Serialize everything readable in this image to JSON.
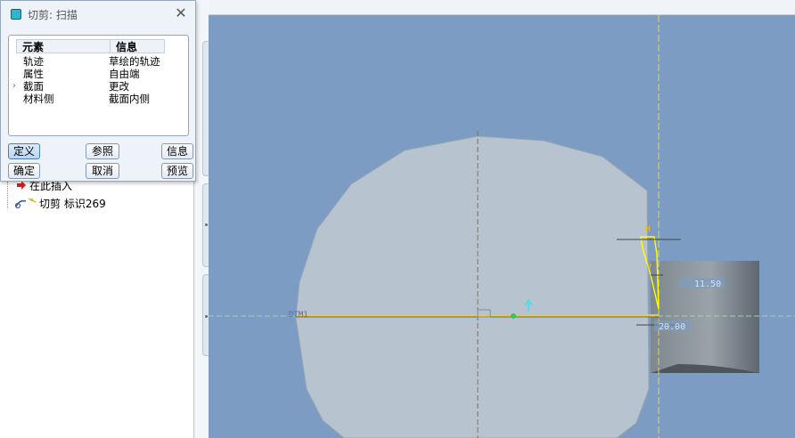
{
  "dialog": {
    "title": "切剪: 扫描",
    "columns": [
      "元素",
      "信息"
    ],
    "rows": [
      {
        "element": "轨迹",
        "info": "草绘的轨迹"
      },
      {
        "element": "属性",
        "info": "自由端"
      },
      {
        "element": "截面",
        "info": "更改"
      },
      {
        "element": "材料侧",
        "info": "截面内侧"
      }
    ],
    "buttons": {
      "define": "定义",
      "refs": "参照",
      "info": "信息",
      "ok": "确定",
      "cancel": "取消",
      "preview": "预览"
    }
  },
  "model_tree": {
    "items": [
      {
        "label": "在此插入"
      },
      {
        "label": "切剪 标识269"
      }
    ]
  },
  "sketch": {
    "labels": {
      "datum": "DTM1",
      "dim_1": "11.50",
      "dim_2": "20.00",
      "small_a": "H",
      "small_b": "V"
    }
  },
  "colors": {
    "graphics_bg": "#7d9cc3",
    "part_face": "#b7c4cf",
    "sketch_yellow": "#ffff00",
    "centerline": "#d8d860"
  }
}
